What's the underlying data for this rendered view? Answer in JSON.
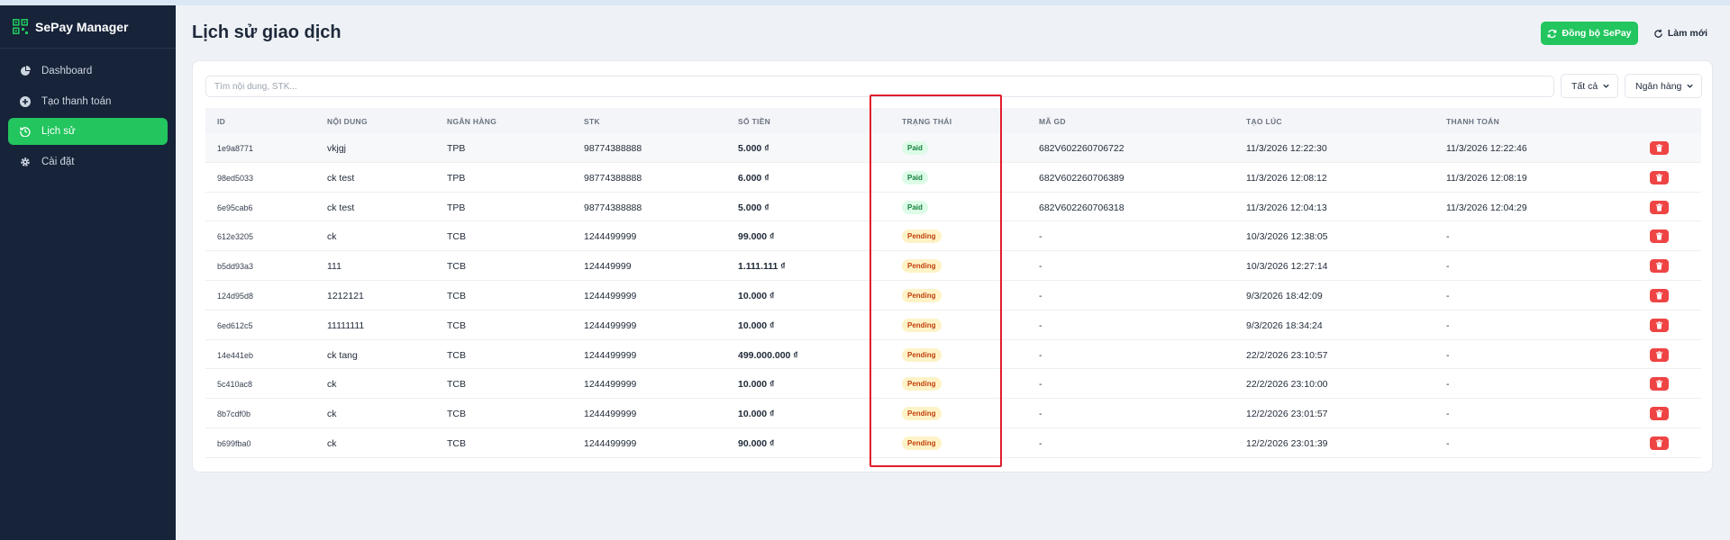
{
  "app": {
    "name": "SePay Manager"
  },
  "sidebar": {
    "items": [
      {
        "label": "Dashboard",
        "icon": "pie-chart-icon",
        "active": false
      },
      {
        "label": "Tạo thanh toán",
        "icon": "plus-circle-icon",
        "active": false
      },
      {
        "label": "Lịch sử",
        "icon": "history-icon",
        "active": true
      },
      {
        "label": "Cài đặt",
        "icon": "gear-icon",
        "active": false
      }
    ]
  },
  "header": {
    "title": "Lịch sử giao dịch",
    "sync_label": "Đồng bộ SePay",
    "refresh_label": "Làm mới"
  },
  "filters": {
    "search_placeholder": "Tìm nội dung, STK...",
    "status_value": "Tất cả",
    "bank_value": "Ngân hàng"
  },
  "table": {
    "columns": [
      "ID",
      "NỘI DUNG",
      "NGÂN HÀNG",
      "STK",
      "SỐ TIỀN",
      "TRẠNG THÁI",
      "MÃ GD",
      "TẠO LÚC",
      "THANH TOÁN"
    ],
    "rows": [
      {
        "id": "1e9a8771",
        "content": "vkjgj",
        "bank": "TPB",
        "stk": "98774388888",
        "amount": "5.000 ₫",
        "status": "Paid",
        "ma_gd": "682V602260706722",
        "created": "11/3/2026 12:22:30",
        "paid": "11/3/2026 12:22:46"
      },
      {
        "id": "98ed5033",
        "content": "ck test",
        "bank": "TPB",
        "stk": "98774388888",
        "amount": "6.000 ₫",
        "status": "Paid",
        "ma_gd": "682V602260706389",
        "created": "11/3/2026 12:08:12",
        "paid": "11/3/2026 12:08:19"
      },
      {
        "id": "6e95cab6",
        "content": "ck test",
        "bank": "TPB",
        "stk": "98774388888",
        "amount": "5.000 ₫",
        "status": "Paid",
        "ma_gd": "682V602260706318",
        "created": "11/3/2026 12:04:13",
        "paid": "11/3/2026 12:04:29"
      },
      {
        "id": "612e3205",
        "content": "ck",
        "bank": "TCB",
        "stk": "1244499999",
        "amount": "99.000 ₫",
        "status": "Pending",
        "ma_gd": "-",
        "created": "10/3/2026 12:38:05",
        "paid": "-"
      },
      {
        "id": "b5dd93a3",
        "content": "111",
        "bank": "TCB",
        "stk": "124449999",
        "amount": "1.111.111 ₫",
        "status": "Pending",
        "ma_gd": "-",
        "created": "10/3/2026 12:27:14",
        "paid": "-"
      },
      {
        "id": "124d95d8",
        "content": "1212121",
        "bank": "TCB",
        "stk": "1244499999",
        "amount": "10.000 ₫",
        "status": "Pending",
        "ma_gd": "-",
        "created": "9/3/2026 18:42:09",
        "paid": "-"
      },
      {
        "id": "6ed612c5",
        "content": "11111111",
        "bank": "TCB",
        "stk": "1244499999",
        "amount": "10.000 ₫",
        "status": "Pending",
        "ma_gd": "-",
        "created": "9/3/2026 18:34:24",
        "paid": "-"
      },
      {
        "id": "14e441eb",
        "content": "ck tang",
        "bank": "TCB",
        "stk": "1244499999",
        "amount": "499.000.000 ₫",
        "status": "Pending",
        "ma_gd": "-",
        "created": "22/2/2026 23:10:57",
        "paid": "-"
      },
      {
        "id": "5c410ac8",
        "content": "ck",
        "bank": "TCB",
        "stk": "1244499999",
        "amount": "10.000 ₫",
        "status": "Pending",
        "ma_gd": "-",
        "created": "22/2/2026 23:10:00",
        "paid": "-"
      },
      {
        "id": "8b7cdf0b",
        "content": "ck",
        "bank": "TCB",
        "stk": "1244499999",
        "amount": "10.000 ₫",
        "status": "Pending",
        "ma_gd": "-",
        "created": "12/2/2026 23:01:57",
        "paid": "-"
      },
      {
        "id": "b699fba0",
        "content": "ck",
        "bank": "TCB",
        "stk": "1244499999",
        "amount": "90.000 ₫",
        "status": "Pending",
        "ma_gd": "-",
        "created": "12/2/2026 23:01:39",
        "paid": "-"
      }
    ]
  },
  "colors": {
    "accent": "#22c55e",
    "sidebar_bg": "#172339",
    "danger": "#ef4444",
    "highlight": "#e11d2e"
  }
}
